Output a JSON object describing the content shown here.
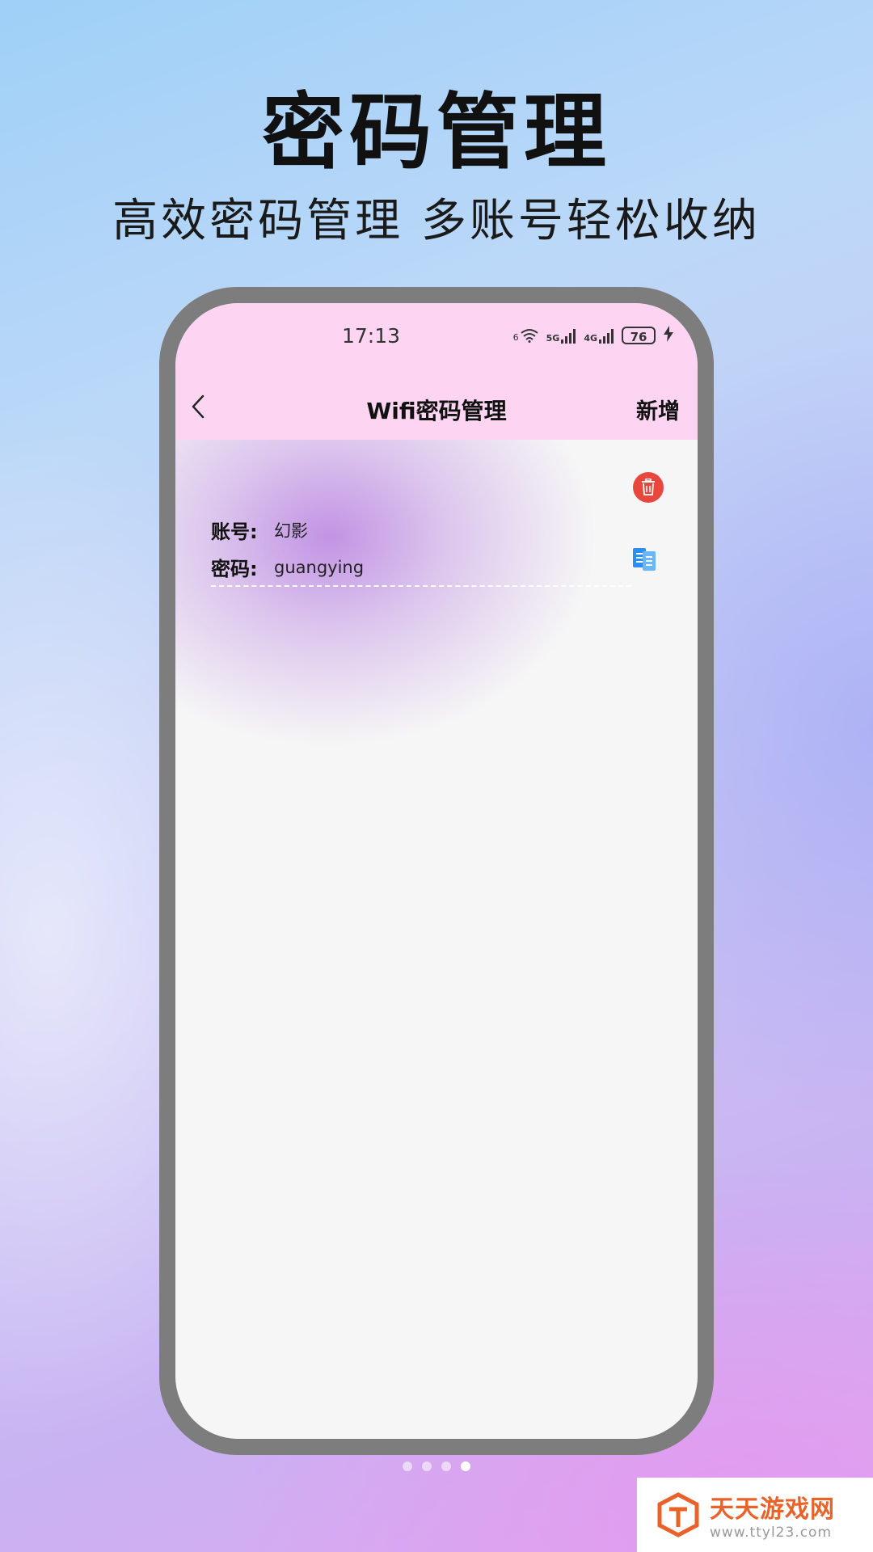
{
  "hero": {
    "title": "密码管理",
    "subtitle": "高效密码管理  多账号轻松收纳"
  },
  "status_bar": {
    "time": "17:13",
    "wifi_label": "6",
    "signal1_label": "5G",
    "signal2_label": "4G",
    "battery": "76"
  },
  "nav": {
    "title": "Wifi密码管理",
    "add_label": "新增"
  },
  "entry": {
    "account_label": "账号:",
    "account_value": "幻影",
    "password_label": "密码:",
    "password_value": "guangying"
  },
  "pager": {
    "count": 4,
    "active_index": 3
  },
  "watermark": {
    "name": "天天游戏网",
    "url": "www.ttyl23.com"
  },
  "colors": {
    "header_bg": "#fdd5f2",
    "delete_red": "#e8473e",
    "copy_blue": "#2b8ff0",
    "frame_gray": "#7d7d7d"
  }
}
